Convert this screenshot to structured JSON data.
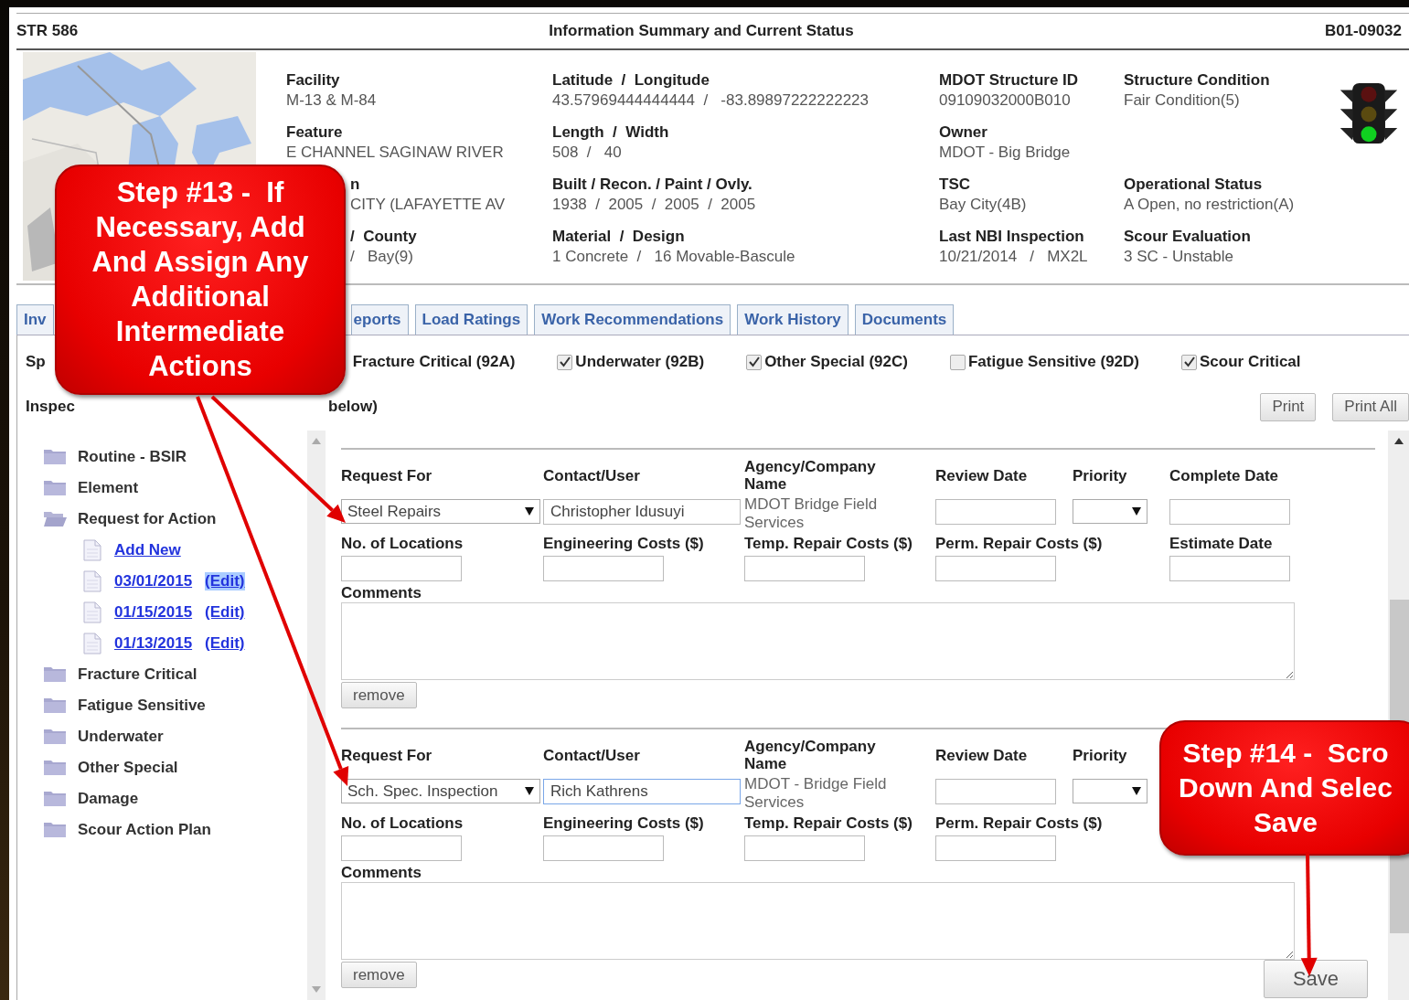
{
  "header": {
    "id": "STR 586",
    "title": "Information Summary and Current Status",
    "code": "B01-09032"
  },
  "info_rows": [
    {
      "cells": [
        {
          "label": "Facility",
          "value": "M-13 & M-84"
        },
        {
          "label": "Latitude  /  Longitude",
          "value": "43.57969444444444  /   -83.89897222222223"
        },
        {
          "label": "MDOT Structure ID",
          "value": "09109032000B010"
        },
        {
          "label": "Structure Condition",
          "value": "Fair Condition(5)"
        }
      ]
    },
    {
      "cells": [
        {
          "label": "Feature",
          "value": "E CHANNEL SAGINAW RIVER"
        },
        {
          "label": "Length  /  Width",
          "value": "508  /   40"
        },
        {
          "label": "Owner",
          "value": "MDOT - Big Bridge"
        }
      ]
    },
    {
      "cells": [
        {
          "label": "n",
          "value": "CITY (LAFAYETTE AV",
          "covered": true
        },
        {
          "label": "Built / Recon. / Paint / Ovly.",
          "value": "1938  /  2005  /  2005  /  2005"
        },
        {
          "label": "TSC",
          "value": "Bay City(4B)"
        },
        {
          "label": "Operational Status",
          "value": "A Open, no restriction(A)"
        }
      ]
    },
    {
      "cells": [
        {
          "label": "/  County",
          "value": "/   Bay(9)",
          "covered": true
        },
        {
          "label": "Material  /  Design",
          "value": "1 Concrete  /   16 Movable-Bascule"
        },
        {
          "label": "Last NBI Inspection",
          "value": "10/21/2014   /   MX2L"
        },
        {
          "label": "Scour Evaluation",
          "value": "3 SC - Unstable"
        }
      ]
    }
  ],
  "tabs": [
    {
      "label": "Inv",
      "selected": false,
      "covered": false
    },
    {
      "label": "eports",
      "selected": false,
      "covered": true
    },
    {
      "label": "Load Ratings",
      "selected": false,
      "covered": false
    },
    {
      "label": "Work Recommendations",
      "selected": false,
      "covered": false
    },
    {
      "label": "Work History",
      "selected": false,
      "covered": false
    },
    {
      "label": "Documents",
      "selected": false,
      "covered": false
    }
  ],
  "special_label": "Sp",
  "special": [
    {
      "label": "Fracture Critical (92A)",
      "kind": "covered"
    },
    {
      "label": "Underwater (92B)",
      "kind": "checkbox",
      "checked": true
    },
    {
      "label": "Other Special (92C)",
      "kind": "checkbox",
      "checked": true
    },
    {
      "label": "Fatigue Sensitive (92D)",
      "kind": "checkbox",
      "checked": false
    },
    {
      "label": "Scour Critical",
      "kind": "checkbox",
      "checked": true
    }
  ],
  "inspection": {
    "label_start": "Inspec",
    "label_end": "below)",
    "buttons": [
      "Print",
      "Print All"
    ]
  },
  "tree": [
    {
      "label": "Routine -  BSIR",
      "expanded": false
    },
    {
      "label": "Element",
      "expanded": false
    },
    {
      "label": "Request for Action",
      "expanded": true,
      "children": [
        {
          "label": "Add New",
          "kind": "add",
          "selected": false
        },
        {
          "label": "03/01/2015",
          "edit": "(Edit)",
          "kind": "entry",
          "selected": true
        },
        {
          "label": "01/15/2015",
          "edit": "(Edit)",
          "kind": "entry",
          "selected": false
        },
        {
          "label": "01/13/2015",
          "edit": "(Edit)",
          "kind": "entry",
          "selected": false
        }
      ]
    },
    {
      "label": "Fracture Critical",
      "expanded": false
    },
    {
      "label": "Fatigue Sensitive",
      "expanded": false
    },
    {
      "label": "Underwater",
      "expanded": false
    },
    {
      "label": "Other Special",
      "expanded": false
    },
    {
      "label": "Damage",
      "expanded": false
    },
    {
      "label": "Scour Action Plan",
      "expanded": false
    }
  ],
  "forms": [
    {
      "fields": [
        {
          "label": "Request For",
          "kind": "select",
          "value": "Steel Repairs"
        },
        {
          "label": "Contact/User",
          "kind": "input",
          "value": "Christopher Idusuyi",
          "focused": false
        },
        {
          "label": "Agency/Company Name",
          "kind": "text",
          "value": "MDOT Bridge Field Services"
        },
        {
          "label": "Review Date",
          "kind": "input",
          "focused": false
        },
        {
          "label": "Priority",
          "kind": "select"
        },
        {
          "label": "Complete Date",
          "kind": "input",
          "focused": false
        }
      ],
      "costs": [
        {
          "label": "No. of Locations",
          "kind": "input"
        },
        {
          "label": "Engineering Costs ($)",
          "kind": "input"
        },
        {
          "label": "Temp. Repair Costs ($)",
          "kind": "input"
        },
        {
          "label": "Perm. Repair Costs ($)",
          "kind": "input"
        },
        {
          "kind": "spacer"
        },
        {
          "label": "Estimate Date",
          "kind": "input"
        }
      ],
      "comments_label": "Comments",
      "remove": "remove"
    },
    {
      "fields": [
        {
          "label": "Request For",
          "kind": "select",
          "value": "Sch. Spec. Inspection"
        },
        {
          "label": "Contact/User",
          "kind": "input",
          "value": "Rich Kathrens",
          "focused": true
        },
        {
          "label": "Agency/Company Name",
          "kind": "text",
          "value": "MDOT - Bridge Field Services"
        },
        {
          "label": "Review Date",
          "kind": "input",
          "focused": false
        },
        {
          "label": "Priority",
          "kind": "select"
        }
      ],
      "costs": [
        {
          "label": "No. of Locations",
          "kind": "input"
        },
        {
          "label": "Engineering Costs ($)",
          "kind": "input"
        },
        {
          "label": "Temp. Repair Costs ($)",
          "kind": "input"
        },
        {
          "label": "Perm. Repair Costs ($)",
          "kind": "input"
        }
      ],
      "comments_label": "Comments",
      "remove": "remove",
      "save": "Save"
    }
  ],
  "callouts": [
    {
      "lines": [
        "Step #13 -  If",
        "Necessary, Add",
        "And Assign Any",
        "Additional",
        "Intermediate",
        "Actions"
      ]
    },
    {
      "lines": [
        "Step #14 -  Scro",
        "Down And Selec",
        "Save"
      ]
    }
  ]
}
